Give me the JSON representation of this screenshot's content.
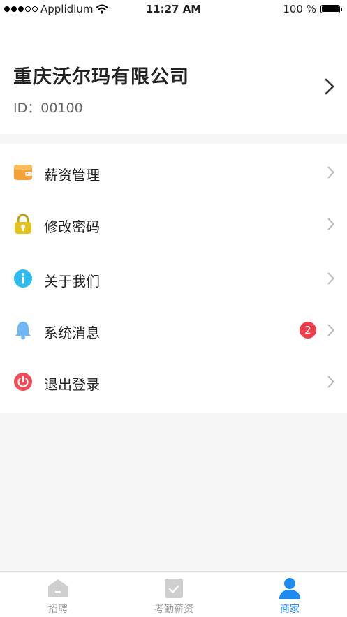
{
  "status_bar": {
    "carrier": "Applidium",
    "time": "11:27 AM",
    "battery": "100 %"
  },
  "profile": {
    "company_name": "重庆沃尔玛有限公司",
    "id_text": "ID：00100"
  },
  "menu": {
    "items": [
      {
        "label": "薪资管理",
        "icon": "wallet-icon",
        "color": "#f5a13a"
      },
      {
        "label": "修改密码",
        "icon": "lock-icon",
        "color": "#e2c21f"
      },
      {
        "label": "关于我们",
        "icon": "info-icon",
        "color": "#2cbcef"
      },
      {
        "label": "系统消息",
        "icon": "bell-icon",
        "color": "#6fb6f5",
        "badge": "2"
      },
      {
        "label": "退出登录",
        "icon": "power-icon",
        "color": "#ee4b57"
      }
    ]
  },
  "tabbar": {
    "tabs": [
      {
        "label": "招聘",
        "icon": "home-icon",
        "active": false
      },
      {
        "label": "考勤薪资",
        "icon": "checklist-icon",
        "active": false
      },
      {
        "label": "商家",
        "icon": "user-icon",
        "active": true
      }
    ]
  },
  "colors": {
    "accent": "#1d8cf0",
    "badge": "#ef3d4b",
    "background": "#f5f5f5"
  }
}
